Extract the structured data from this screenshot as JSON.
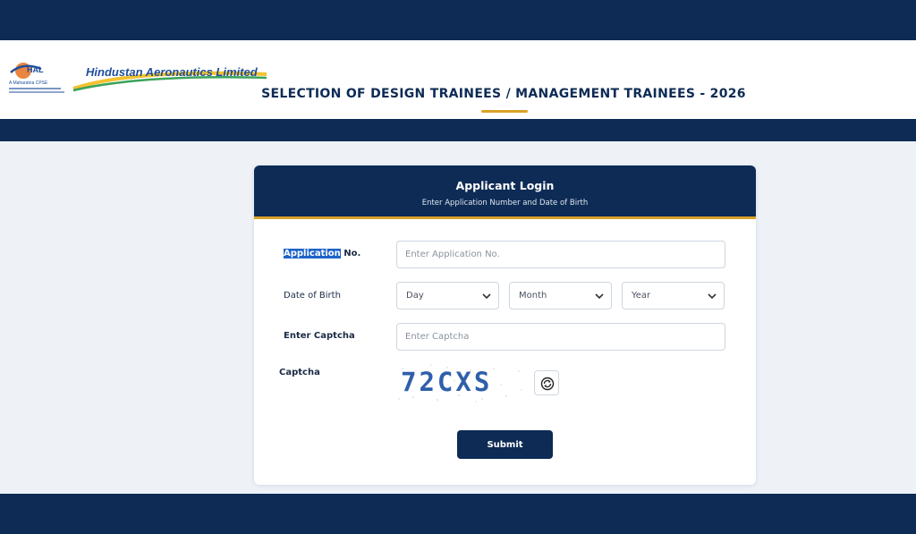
{
  "header": {
    "logo_emblem_text": "HAL",
    "logo_emblem_tagline": "A Maharatna CPSE",
    "logo_wordmark": "Hindustan Aeronautics Limited",
    "title": "SELECTION OF DESIGN TRAINEES / MANAGEMENT TRAINEES - 2026"
  },
  "login": {
    "title": "Applicant Login",
    "subtitle": "Enter Application Number and Date of Birth",
    "application_label_highlight": "Application",
    "application_label_rest": " No.",
    "application_placeholder": "Enter Application No.",
    "dob_label": "Date of Birth",
    "day_selected": "Day",
    "month_selected": "Month",
    "year_selected": "Year",
    "captcha_input_label": "Enter Captcha",
    "captcha_placeholder": "Enter Captcha",
    "captcha_label": "Captcha",
    "captcha_text": "72CXS",
    "submit_label": "Submit"
  },
  "colors": {
    "navy": "#0d2b55",
    "gold": "#d9a227",
    "page_bg": "#eef2f7"
  },
  "icons": {
    "refresh": "refresh-icon",
    "chevron": "chevron-down-icon"
  }
}
